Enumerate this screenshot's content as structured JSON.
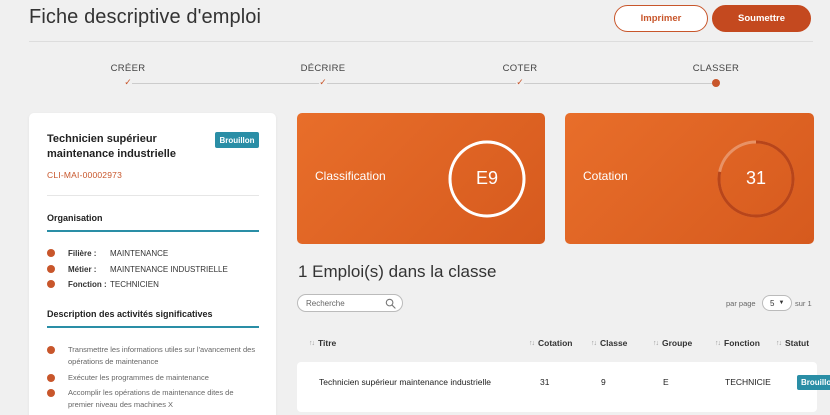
{
  "header": {
    "title": "Fiche descriptive d'emploi",
    "print_label": "Imprimer",
    "submit_label": "Soumettre"
  },
  "stepper": {
    "steps": [
      {
        "label": "CRÉER",
        "state": "done"
      },
      {
        "label": "DÉCRIRE",
        "state": "done"
      },
      {
        "label": "COTER",
        "state": "done"
      },
      {
        "label": "CLASSER",
        "state": "current"
      }
    ]
  },
  "job": {
    "title": "Technicien supérieur maintenance industrielle",
    "status": "Brouillon",
    "code": "CLI-MAI-00002973"
  },
  "organisation": {
    "section_title": "Organisation",
    "rows": [
      {
        "key": "Filière :",
        "value": "MAINTENANCE"
      },
      {
        "key": "Métier :",
        "value": "MAINTENANCE INDUSTRIELLE"
      },
      {
        "key": "Fonction :",
        "value": "TECHNICIEN"
      }
    ]
  },
  "activities": {
    "section_title": "Description des activités significatives",
    "items": [
      "Transmettre les informations utiles sur l'avancement des opérations de maintenance",
      "Exécuter les programmes de maintenance",
      "Accomplir les opérations de maintenance dites de premier niveau des machines X"
    ]
  },
  "tiles": {
    "classification": {
      "label": "Classification",
      "value": "E9",
      "ring_fill": 1.0
    },
    "cotation": {
      "label": "Cotation",
      "value": "31",
      "ring_fill": 0.78
    }
  },
  "list": {
    "count_title": "1 Emploi(s) dans la classe",
    "search_placeholder": "Recherche",
    "per_page_label": "par page",
    "per_page_value": "5",
    "per_page_suffix": "sur 1",
    "columns": [
      "Titre",
      "Cotation",
      "Classe",
      "Groupe",
      "Fonction",
      "Statut"
    ],
    "rows": [
      {
        "titre": "Technicien supérieur maintenance industrielle",
        "cotation": "31",
        "classe": "9",
        "groupe": "E",
        "fonction": "TECHNICIE",
        "statut": "Brouillon"
      }
    ]
  },
  "colors": {
    "accent": "#c8562b",
    "tile_orange": "#e0641f",
    "teal": "#2a8ea6"
  },
  "icons": {
    "search": "search-icon",
    "sort": "sort-icon",
    "check": "check-icon",
    "chevron": "chevron-down-icon"
  }
}
